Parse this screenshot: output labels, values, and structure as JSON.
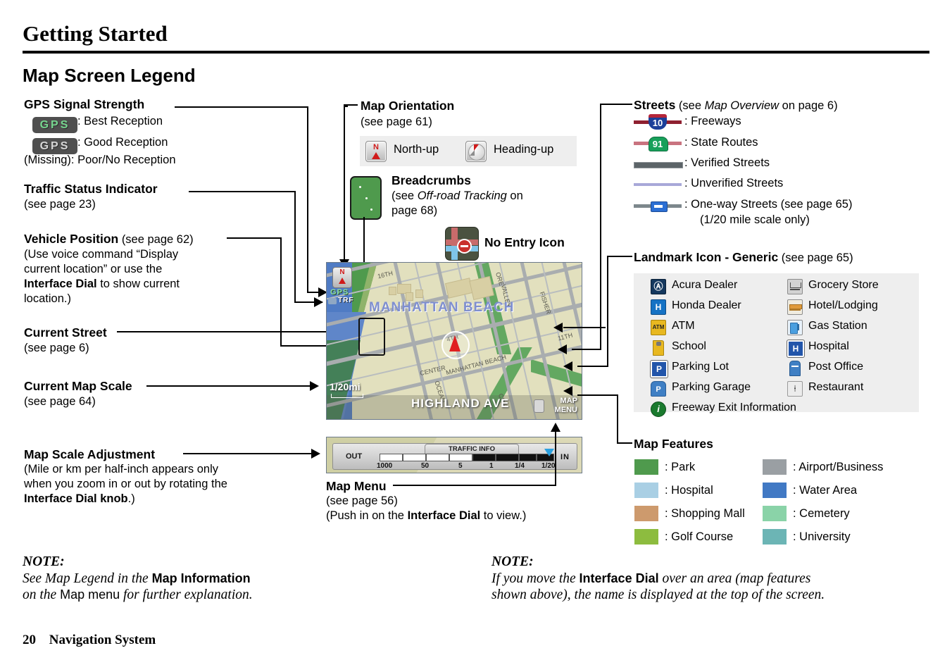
{
  "header": {
    "chapter": "Getting Started",
    "section": "Map Screen Legend"
  },
  "left_callouts": {
    "gps": {
      "title": "GPS Signal Strength",
      "best_badge": "GPS",
      "best_label": ": Best Reception",
      "good_badge": "GPS",
      "good_label": ": Good Reception",
      "missing_label": "(Missing): Poor/No Reception"
    },
    "traffic": {
      "title": "Traffic Status Indicator",
      "sub": "(see page 23)"
    },
    "vehicle_position": {
      "title": "Vehicle Position",
      "title_sub": "(see page 62)",
      "line1_a": "(Use voice command “Display",
      "line2_a": "current location” or use the",
      "line3_b": "Interface Dial",
      "line3_a": " to show current",
      "line4_a": "location.)"
    },
    "current_street": {
      "title": "Current Street",
      "sub": "(see page 6)"
    },
    "current_map_scale": {
      "title": "Current Map Scale",
      "sub": "(see page 64)"
    },
    "map_scale_adjustment": {
      "title": "Map Scale Adjustment",
      "line1": "(Mile or km per half-inch appears only",
      "line2": "when you zoom in or out by rotating the",
      "line3_b": "Interface Dial knob",
      "line3_a": ".)"
    }
  },
  "center_callouts": {
    "map_orientation": {
      "title": "Map Orientation",
      "sub": "(see page 61)",
      "north_up": "North-up",
      "heading_up": "Heading-up"
    },
    "breadcrumbs": {
      "title": "Breadcrumbs",
      "line1_a": "(see ",
      "line1_i": "Off-road Tracking",
      "line1_b": " on",
      "line2": "page 68)"
    },
    "no_entry": {
      "label": "No Entry Icon"
    },
    "map_menu": {
      "title": "Map Menu",
      "sub": "(see page 56)",
      "line2_a": "(Push in on the ",
      "line2_b": "Interface Dial",
      "line2_c": " to view.)"
    }
  },
  "map_screen": {
    "city_name": "MANHATTAN BEACH",
    "current_street": "HIGHLAND AVE",
    "gps_indicator": "GPS",
    "traffic_indicator": "TRF",
    "scale_label": "1/20mi",
    "map_menu_line1": "MAP",
    "map_menu_line2": "MENU",
    "street_labels": [
      "16TH",
      "VALLEY",
      "FISHER",
      "11TH",
      "CENTER",
      "MANHATTAN BEACH",
      "OCEAN",
      "CRE",
      "ORE",
      "4TH"
    ]
  },
  "scale_adjust_bar": {
    "out_label": "OUT",
    "in_label": "IN",
    "traffic_tab": "TRAFFIC INFO",
    "ticks": [
      "1000",
      "50",
      "5",
      "1",
      "1/4",
      "1/20"
    ],
    "active_tick": "1/20"
  },
  "streets": {
    "title": "Streets",
    "title_sub_a": " (see ",
    "title_sub_i": "Map Overview",
    "title_sub_b": " on page 6)",
    "items": [
      {
        "icon": "interstate-shield",
        "number": "10",
        "label": ": Freeways"
      },
      {
        "icon": "state-route-shield",
        "number": "91",
        "label": ": State Routes"
      },
      {
        "icon": "verified-street-line",
        "number": "",
        "label": ": Verified Streets"
      },
      {
        "icon": "unverified-street-line",
        "number": "",
        "label": ": Unverified Streets"
      },
      {
        "icon": "one-way-street-line",
        "number": "",
        "label": ": One-way Streets (see page 65)"
      }
    ],
    "one_way_sub": "(1/20 mile scale only)",
    "colors": {
      "freeway_line": "#8f2030",
      "state_line": "#c9737f",
      "verified": "#5c6468",
      "unverified": "#a8a8d8",
      "oneway": "#7d878c"
    }
  },
  "landmarks": {
    "title": "Landmark Icon - Generic",
    "title_sub": " (see page 65)",
    "left_column": [
      {
        "icon": "acura-dealer-icon",
        "label": "Acura Dealer",
        "glyph": "Ⓐ",
        "bg": "#14385e",
        "fg": "#ffffff"
      },
      {
        "icon": "honda-dealer-icon",
        "label": "Honda Dealer",
        "glyph": "H",
        "bg": "#1572c4",
        "fg": "#ffffff"
      },
      {
        "icon": "atm-icon",
        "label": "ATM",
        "glyph": "ATM",
        "bg": "#e8b820",
        "fg": "#222222"
      },
      {
        "icon": "school-icon",
        "label": "School",
        "glyph": "♪",
        "bg": "#e8b820",
        "fg": "#555555"
      },
      {
        "icon": "parking-lot-icon",
        "label": "Parking Lot",
        "glyph": "P",
        "bg": "#2255aa",
        "fg": "#ffffff"
      },
      {
        "icon": "parking-garage-icon",
        "label": "Parking Garage",
        "glyph": "P",
        "bg": "#3f7fc4",
        "fg": "#ffffff"
      },
      {
        "icon": "freeway-exit-info-icon",
        "label": "Freeway Exit Information",
        "glyph": "i",
        "bg": "#1a7a2e",
        "fg": "#ffffff"
      }
    ],
    "right_column": [
      {
        "icon": "grocery-store-icon",
        "label": "Grocery Store",
        "glyph": "▤",
        "bg": "#c9c9c9",
        "fg": "#3a3a3a"
      },
      {
        "icon": "hotel-lodging-icon",
        "label": "Hotel/Lodging",
        "glyph": "☰",
        "bg": "#e09a3a",
        "fg": "#ffffff"
      },
      {
        "icon": "gas-station-icon",
        "label": "Gas Station",
        "glyph": "⛽",
        "bg": "#4a9fe0",
        "fg": "#ffffff"
      },
      {
        "icon": "hospital-icon",
        "label": "Hospital",
        "glyph": "H",
        "bg": "#2255aa",
        "fg": "#ffffff"
      },
      {
        "icon": "post-office-icon",
        "label": "Post Office",
        "glyph": "✉",
        "bg": "#3f7fc4",
        "fg": "#ffffff"
      },
      {
        "icon": "restaurant-icon",
        "label": "Restaurant",
        "glyph": "⑄",
        "bg": "#e9e9e9",
        "fg": "#3a3a3a"
      }
    ]
  },
  "map_features": {
    "title": "Map Features",
    "left_column": [
      {
        "label": ": Park",
        "color": "#4f9a4d"
      },
      {
        "label": ": Hospital",
        "color": "#a9cfe4"
      },
      {
        "label": ": Shopping Mall",
        "color": "#cd9a6d"
      },
      {
        "label": ": Golf Course",
        "color": "#8dbc3f"
      }
    ],
    "right_column": [
      {
        "label": ": Airport/Business",
        "color": "#9a9fa3"
      },
      {
        "label": ": Water Area",
        "color": "#4179c4"
      },
      {
        "label": ": Cemetery",
        "color": "#8ad3a8"
      },
      {
        "label": ": University",
        "color": "#6cb5b5"
      }
    ]
  },
  "notes": {
    "left": {
      "heading": "NOTE:",
      "l1_a": "See Map Legend in the ",
      "l1_b": "Map Information",
      "l2_a": "on the ",
      "l2_b": "Map",
      "l2_c": " menu",
      "l2_d": " for further explanation."
    },
    "right": {
      "heading": "NOTE:",
      "l1_a": "If you move the ",
      "l1_b": "Interface Dial",
      "l1_c": " over an area (map features",
      "l2": "shown above), the name is displayed at the top of the screen."
    }
  },
  "footer": {
    "page_number": "20",
    "title": "Navigation System"
  }
}
